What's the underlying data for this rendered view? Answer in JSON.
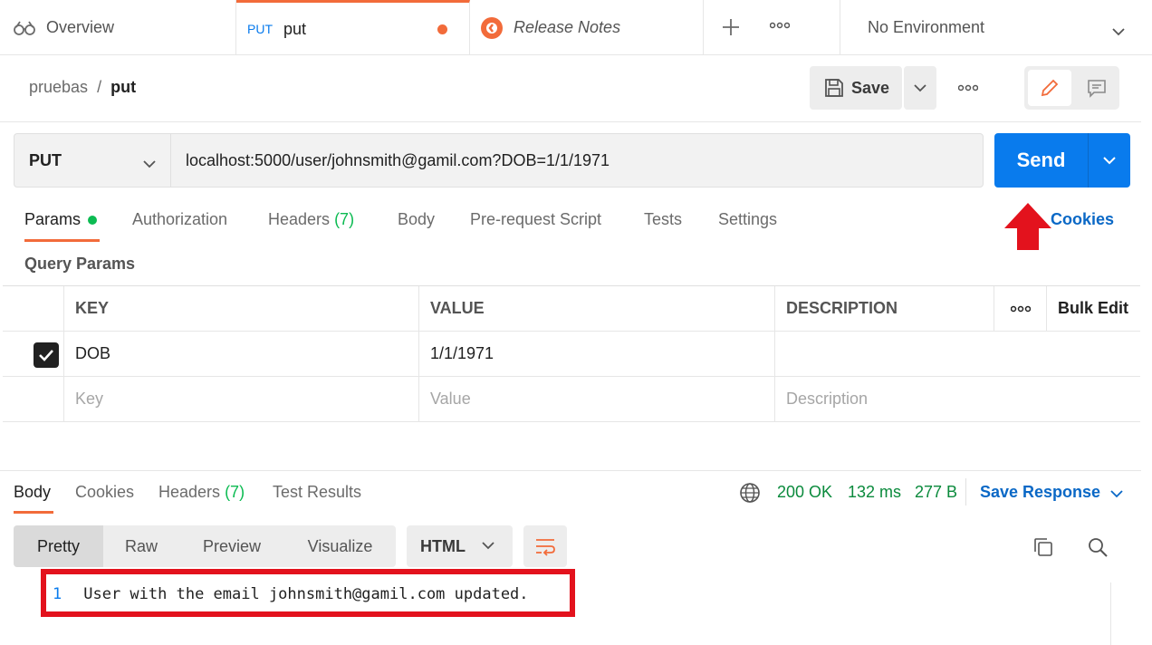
{
  "tabs": {
    "overview": "Overview",
    "put_method": "PUT",
    "put_name": "put",
    "release": "Release Notes",
    "environment": "No Environment"
  },
  "breadcrumb": {
    "folder": "pruebas",
    "separator": "/",
    "name": "put"
  },
  "toolbar": {
    "save_label": "Save"
  },
  "request": {
    "method": "PUT",
    "url": "localhost:5000/user/johnsmith@gamil.com?DOB=1/1/1971",
    "send_label": "Send"
  },
  "request_tabs": {
    "params": "Params",
    "authorization": "Authorization",
    "headers": "Headers",
    "headers_count": "(7)",
    "body": "Body",
    "prerequest": "Pre-request Script",
    "tests": "Tests",
    "settings": "Settings",
    "cookies": "Cookies"
  },
  "query_params": {
    "title": "Query Params",
    "headers": {
      "key": "KEY",
      "value": "VALUE",
      "description": "DESCRIPTION",
      "bulk_edit": "Bulk Edit"
    },
    "rows": [
      {
        "key": "DOB",
        "value": "1/1/1971",
        "checked": true
      }
    ],
    "placeholders": {
      "key": "Key",
      "value": "Value",
      "description": "Description"
    }
  },
  "response": {
    "tabs": {
      "body": "Body",
      "cookies": "Cookies",
      "headers": "Headers",
      "headers_count": "(7)",
      "test_results": "Test Results"
    },
    "status": "200 OK",
    "time": "132 ms",
    "size": "277 B",
    "save_response": "Save Response",
    "views": [
      "Pretty",
      "Raw",
      "Preview",
      "Visualize"
    ],
    "format": "HTML",
    "line_number": "1",
    "body_text": "User with the email johnsmith@gamil.com updated."
  },
  "colors": {
    "accent": "#f26b3a",
    "primary": "#097bed",
    "success": "#0cbb52",
    "highlight": "#e3121d"
  },
  "icons": [
    "binoculars-icon",
    "release-notes-icon",
    "plus-icon",
    "more-icon",
    "chevron-down-icon",
    "save-icon",
    "pencil-icon",
    "comment-icon",
    "checkbox-icon",
    "globe-icon",
    "wrap-icon",
    "copy-icon",
    "search-icon",
    "red-up-arrow-icon"
  ]
}
